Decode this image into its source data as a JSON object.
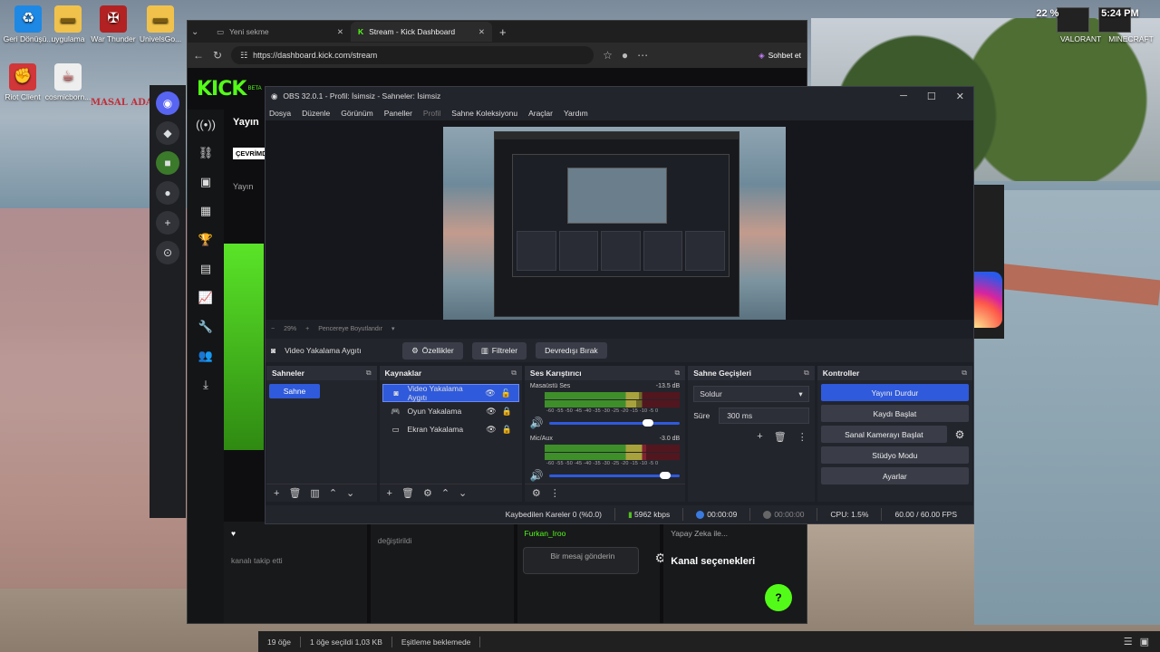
{
  "desktop": {
    "icons": [
      {
        "label": "Geri Dönüşü...",
        "icon": "recycle-bin-icon",
        "color": "#1e88e5"
      },
      {
        "label": "uygulama",
        "icon": "folder-icon",
        "color": "#f1c24b"
      },
      {
        "label": "War Thunder",
        "icon": "war-thunder-icon",
        "color": "#b22222"
      },
      {
        "label": "UnivelsGo...",
        "icon": "folder-icon",
        "color": "#f1c24b"
      },
      {
        "label": "Riot Client",
        "icon": "riot-client-icon",
        "color": "#d13639"
      },
      {
        "label": "cosmicborn...",
        "icon": "java-icon",
        "color": "#eeeeee"
      }
    ],
    "masal_sign": "MASAL ADASI",
    "games": [
      {
        "label": "VALORANT"
      },
      {
        "label": "MINECRAFT"
      }
    ],
    "tray": {
      "battery": "22 %",
      "time": "5:24 PM"
    }
  },
  "browser": {
    "tabs": [
      {
        "label": "Yeni sekme"
      },
      {
        "label": "Stream - Kick Dashboard"
      }
    ],
    "url": "https://dashboard.kick.com/stream",
    "chat_label": "Sohbet et",
    "kick": {
      "logo": "KICK",
      "beta": "BETA",
      "live_label": "Yayın",
      "status_badge": "ÇEVRİMDIŞI",
      "stream_label": "Yayın",
      "follow_text": "kanalı takip etti",
      "changed_text": "değiştirildi",
      "ai_text": "Yapay Zeka ile...",
      "message_placeholder": "Bir mesaj gönderin",
      "channel_options": "Kanal seçenekleri",
      "user_name": "Furkan_Iroo"
    }
  },
  "obs": {
    "title": "OBS 32.0.1 - Profil: İsimsiz - Sahneler: İsimsiz",
    "menu": [
      {
        "label": "Dosya",
        "dim": false
      },
      {
        "label": "Düzenle",
        "dim": false
      },
      {
        "label": "Görünüm",
        "dim": false
      },
      {
        "label": "Paneller",
        "dim": false
      },
      {
        "label": "Profil",
        "dim": true
      },
      {
        "label": "Sahne Koleksiyonu",
        "dim": false
      },
      {
        "label": "Araçlar",
        "dim": false
      },
      {
        "label": "Yardım",
        "dim": false
      }
    ],
    "zoom": "29%",
    "fit_label": "Pencereye Boyutlandır",
    "source_bar": {
      "source_name": "Video Yakalama Aygıtı",
      "properties": "Özellikler",
      "filters": "Filtreler",
      "deactivate": "Devredışı Bırak"
    },
    "scenes": {
      "title": "Sahneler",
      "items": [
        "Sahne"
      ]
    },
    "sources": {
      "title": "Kaynaklar",
      "items": [
        {
          "label": "Video Yakalama Aygıtı",
          "icon": "camera-icon"
        },
        {
          "label": "Oyun Yakalama",
          "icon": "gamepad-icon"
        },
        {
          "label": "Ekran Yakalama",
          "icon": "monitor-icon"
        }
      ]
    },
    "mixer": {
      "title": "Ses Karıştırıcı",
      "channels": [
        {
          "name": "Masaüstü Ses",
          "db": "-13.5 dB",
          "volume": 0.8
        },
        {
          "name": "Mic/Aux",
          "db": "-3.0 dB",
          "volume": 0.93
        }
      ],
      "scale": "-60 -55 -50 -45 -40 -35 -30 -25 -20 -15 -10 -5 0"
    },
    "transitions": {
      "title": "Sahne Geçişleri",
      "type": "Soldur",
      "duration_label": "Süre",
      "duration_value": "300 ms"
    },
    "controls": {
      "title": "Kontroller",
      "buttons": [
        "Yayını Durdur",
        "Kaydı Başlat",
        "Sanal Kamerayı Başlat",
        "Stüdyo Modu",
        "Ayarlar"
      ]
    },
    "status": {
      "dropped": "Kaybedilen Kareler 0 (%0.0)",
      "bitrate": "5962 kbps",
      "stream_time": "00:00:09",
      "rec_time": "00:00:00",
      "cpu": "CPU: 1.5%",
      "fps": "60.00 / 60.00 FPS"
    }
  },
  "explorer": {
    "items": "19 öğe",
    "selected": "1 öğe seçildi  1,03 KB",
    "sync": "Eşitleme beklemede"
  }
}
